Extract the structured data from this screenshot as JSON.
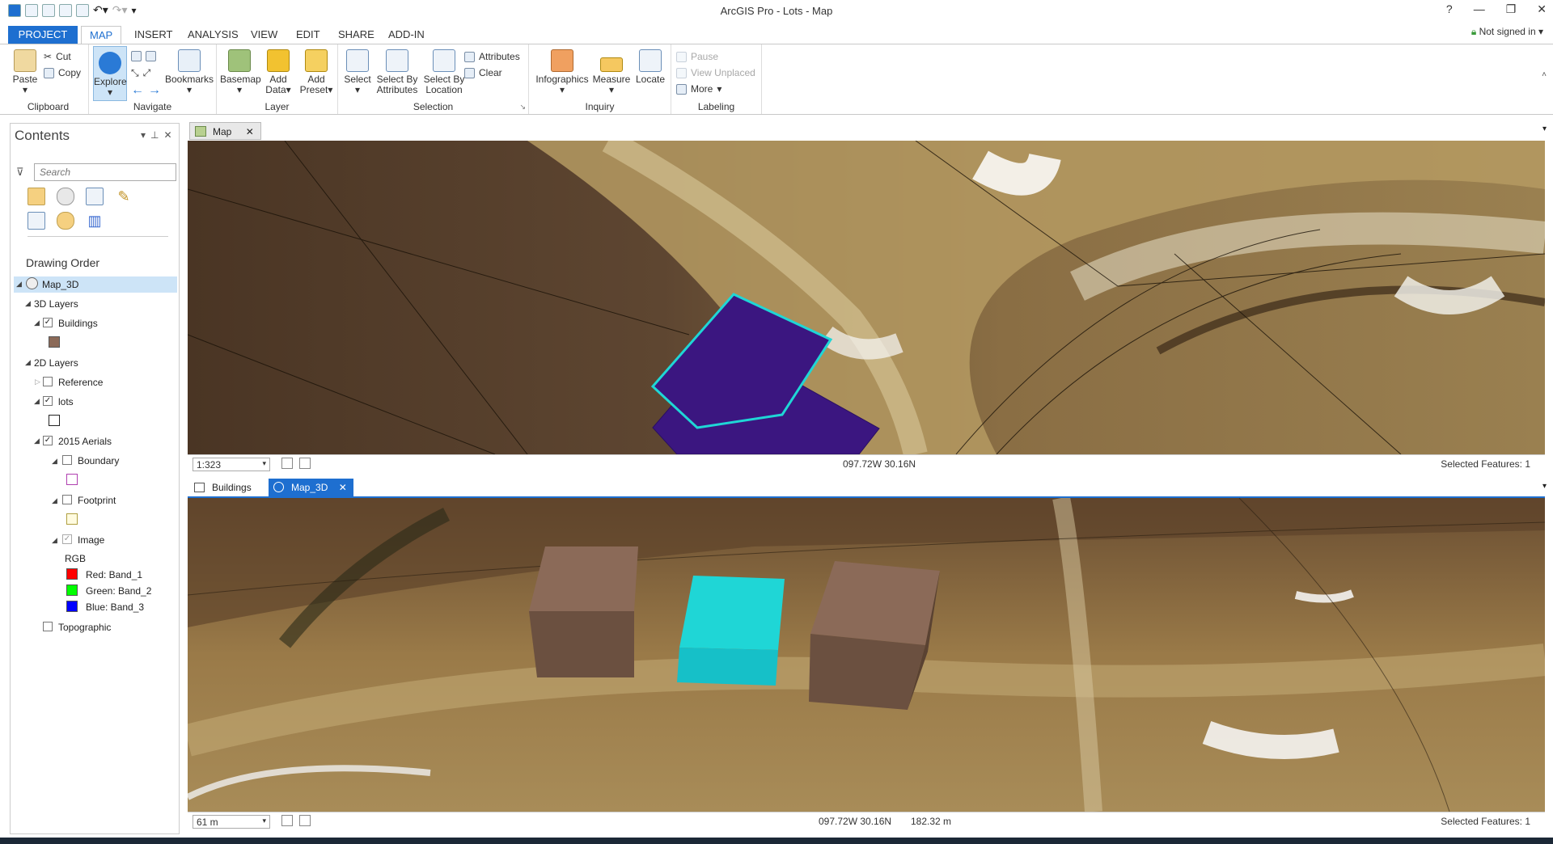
{
  "app_title": "ArcGIS Pro - Lots - Map",
  "window_controls": [
    "?",
    "—",
    "❐",
    "✕"
  ],
  "tabs": [
    "PROJECT",
    "MAP",
    "INSERT",
    "ANALYSIS",
    "VIEW",
    "EDIT",
    "SHARE",
    "ADD-IN"
  ],
  "signin": "Not signed in",
  "ribbon": {
    "clipboard": {
      "label": "Clipboard",
      "paste": "Paste",
      "cut": "Cut",
      "copy": "Copy"
    },
    "navigate": {
      "label": "Navigate",
      "explore": "Explore",
      "bookmarks": "Bookmarks"
    },
    "layer": {
      "label": "Layer",
      "basemap": "Basemap",
      "add_data_1": "Add",
      "add_data_2": "Data",
      "add_preset_1": "Add",
      "add_preset_2": "Preset"
    },
    "selection": {
      "label": "Selection",
      "select": "Select",
      "sba_1": "Select By",
      "sba_2": "Attributes",
      "sbl_1": "Select By",
      "sbl_2": "Location",
      "attributes": "Attributes",
      "clear": "Clear"
    },
    "inquiry": {
      "label": "Inquiry",
      "infographics": "Infographics",
      "measure": "Measure",
      "locate": "Locate"
    },
    "labeling": {
      "label": "Labeling",
      "pause": "Pause",
      "view_unplaced": "View Unplaced",
      "more": "More"
    }
  },
  "contents": {
    "title": "Contents",
    "search_placeholder": "Search",
    "drawing_order": "Drawing Order",
    "map_3d": "Map_3D",
    "layers_3d": "3D Layers",
    "buildings": "Buildings",
    "layers_2d": "2D Layers",
    "reference": "Reference",
    "lots": "lots",
    "aerials": "2015 Aerials",
    "boundary": "Boundary",
    "footprint": "Footprint",
    "image": "Image",
    "rgb": "RGB",
    "red": "Red:   Band_1",
    "green": "Green: Band_2",
    "blue": "Blue:  Band_3",
    "topographic": "Topographic"
  },
  "colors": {
    "accent": "#1e6fd0",
    "building": "#8b6a58",
    "selected": "#1fd6d6",
    "lot_fill": "#3b1680"
  },
  "view_top": {
    "tab": "Map",
    "scale": "1:323",
    "coords": "097.72W 30.16N",
    "selected": "Selected Features: 1"
  },
  "view_bottom": {
    "tab1": "Buildings",
    "tab2": "Map_3D",
    "scale": "61 m",
    "coords": "097.72W 30.16N",
    "elev": "182.32 m",
    "selected": "Selected Features: 1"
  }
}
